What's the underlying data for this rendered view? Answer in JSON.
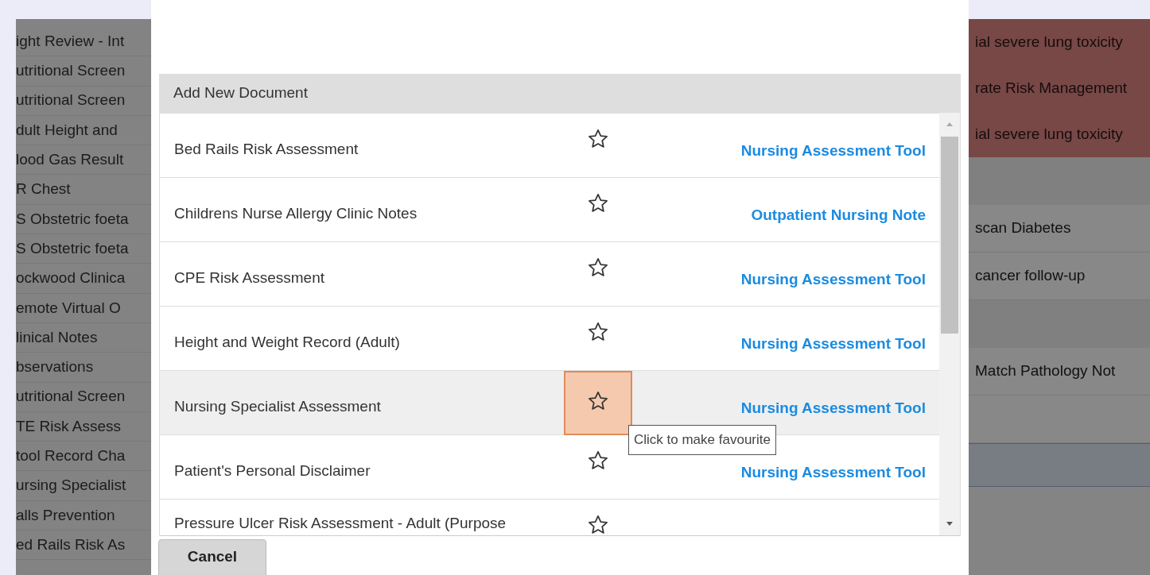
{
  "background_list": [
    "ight Review - Int",
    "utritional Screen",
    "utritional Screen",
    "dult Height and",
    "lood Gas Result",
    "R Chest",
    "S Obstetric foeta",
    "S Obstetric foeta",
    "ockwood Clinica",
    "emote Virtual O",
    "linical Notes",
    "bservations",
    "utritional Screen",
    "TE Risk Assess",
    "tool Record Cha",
    "ursing Specialist",
    "alls Prevention",
    "ed Rails Risk As"
  ],
  "background_rows": [
    {
      "text": "ial severe lung toxicity",
      "kind": "alert"
    },
    {
      "text": "rate Risk Management",
      "kind": "alert"
    },
    {
      "text": "ial severe lung toxicity",
      "kind": "alert"
    },
    {
      "kind": "band"
    },
    {
      "text": "scan Diabetes",
      "kind": "row"
    },
    {
      "text": "cancer follow-up",
      "kind": "row"
    },
    {
      "kind": "band"
    },
    {
      "text": "Match Pathology Not",
      "kind": "row"
    },
    {
      "kind": "row"
    },
    {
      "kind": "selected"
    }
  ],
  "dialog": {
    "section_title": "Add New Document",
    "documents": [
      {
        "name": "Bed Rails Risk Assessment",
        "category": "Nursing Assessment Tool",
        "hovered": false
      },
      {
        "name": "Childrens Nurse Allergy Clinic Notes",
        "category": "Outpatient Nursing Note",
        "hovered": false
      },
      {
        "name": "CPE Risk Assessment",
        "category": "Nursing Assessment Tool",
        "hovered": false
      },
      {
        "name": "Height and Weight Record (Adult)",
        "category": "Nursing Assessment Tool",
        "hovered": false
      },
      {
        "name": "Nursing Specialist Assessment",
        "category": "Nursing Assessment Tool",
        "hovered": true
      },
      {
        "name": "Patient's Personal Disclaimer",
        "category": "Nursing Assessment Tool",
        "hovered": false
      },
      {
        "name": "Pressure Ulcer Risk Assessment - Adult (Purpose",
        "hovered": false
      }
    ],
    "tooltip": "Click to make favourite",
    "cancel_button": "Cancel"
  }
}
